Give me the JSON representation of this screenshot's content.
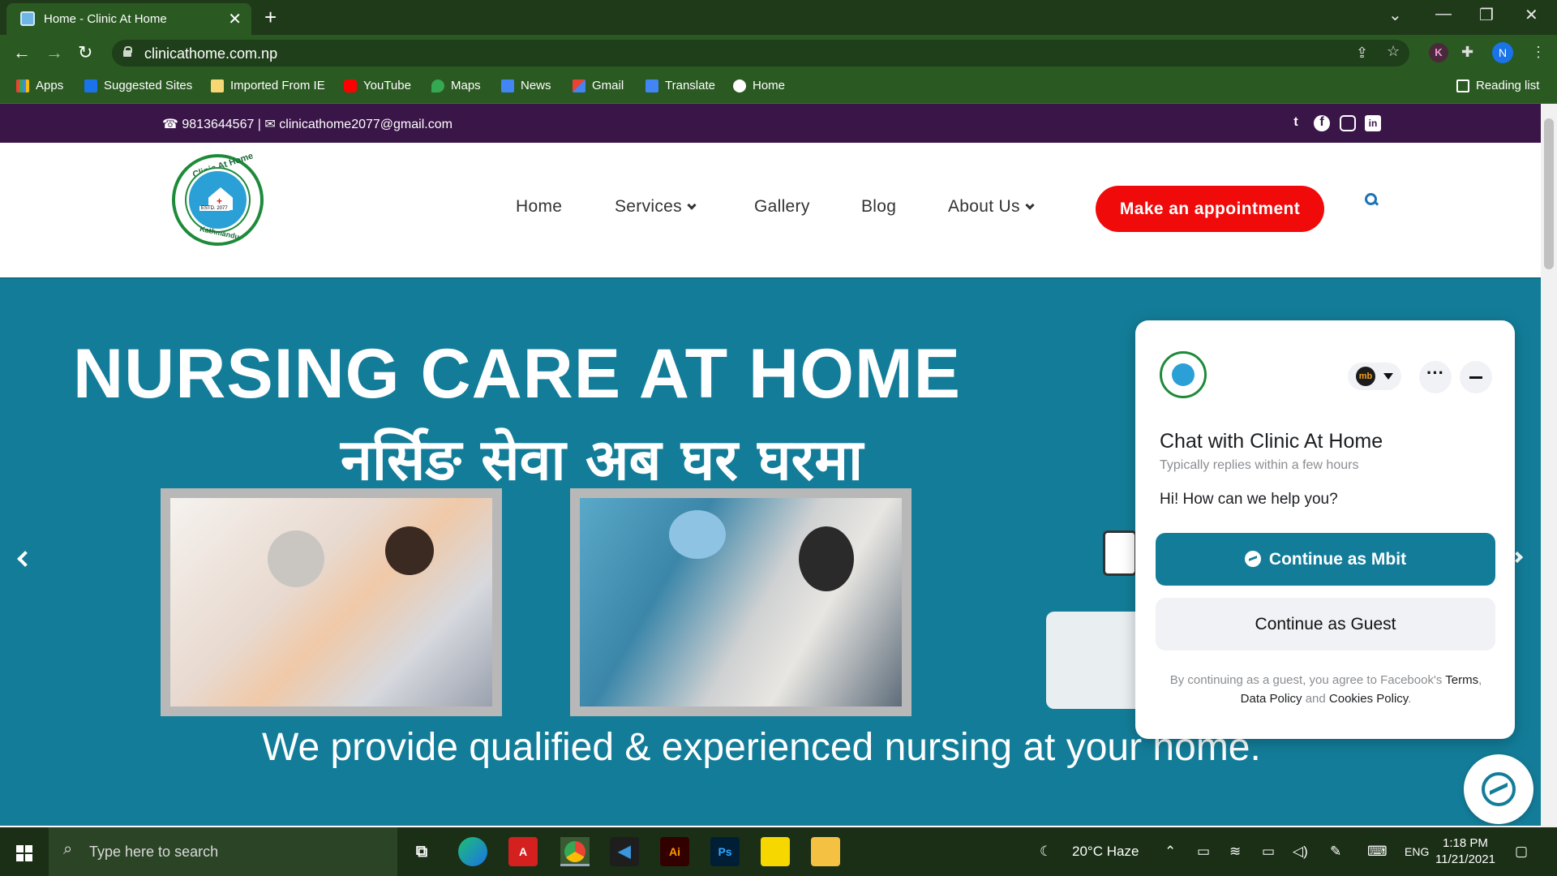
{
  "browser": {
    "tab_title": "Home - Clinic At Home",
    "url": "clinicathome.com.np",
    "bookmarks": [
      "Apps",
      "Suggested Sites",
      "Imported From IE",
      "YouTube",
      "Maps",
      "News",
      "Gmail",
      "Translate",
      "Home"
    ],
    "reading_list": "Reading list",
    "profile_k": "K",
    "profile_n": "N"
  },
  "topbar": {
    "contact": "☎ 9813644567 | ✉ clinicathome2077@gmail.com",
    "social_icons": [
      "twitter-icon",
      "facebook-icon",
      "instagram-icon",
      "linkedin-icon"
    ]
  },
  "header": {
    "logo_top": "Clinic At Home",
    "logo_bottom": "Kathmandu",
    "logo_estd": "ESTD. 2077",
    "nav": [
      "Home",
      "Services",
      "Gallery",
      "Blog",
      "About Us"
    ],
    "cta": "Make an appointment"
  },
  "hero": {
    "title": "NURSING CARE AT HOME",
    "title_np": "नर्सिङ सेवा अब घर घरमा",
    "subtitle": "We provide qualified & experienced nursing at your home."
  },
  "chat": {
    "title": "Chat with Clinic At Home",
    "reply_time": "Typically replies within a few hours",
    "greeting": "Hi! How can we help you?",
    "primary_button": "Continue as Mbit",
    "secondary_button": "Continue as Guest",
    "legal_prefix": "By continuing as a guest, you agree to Facebook's",
    "legal_terms": "Terms",
    "legal_data": "Data Policy",
    "legal_and": "and",
    "legal_cookies": "Cookies Policy",
    "mb_label": "mb"
  },
  "taskbar": {
    "search_placeholder": "Type here to search",
    "weather": "20°C  Haze",
    "lang": "ENG",
    "time": "1:18 PM",
    "date": "11/21/2021"
  },
  "colors": {
    "topbar_bg": "#3a1548",
    "hero_bg": "#137d99",
    "cta_bg": "#f00a0a",
    "chrome_bg": "#2a5a22"
  }
}
